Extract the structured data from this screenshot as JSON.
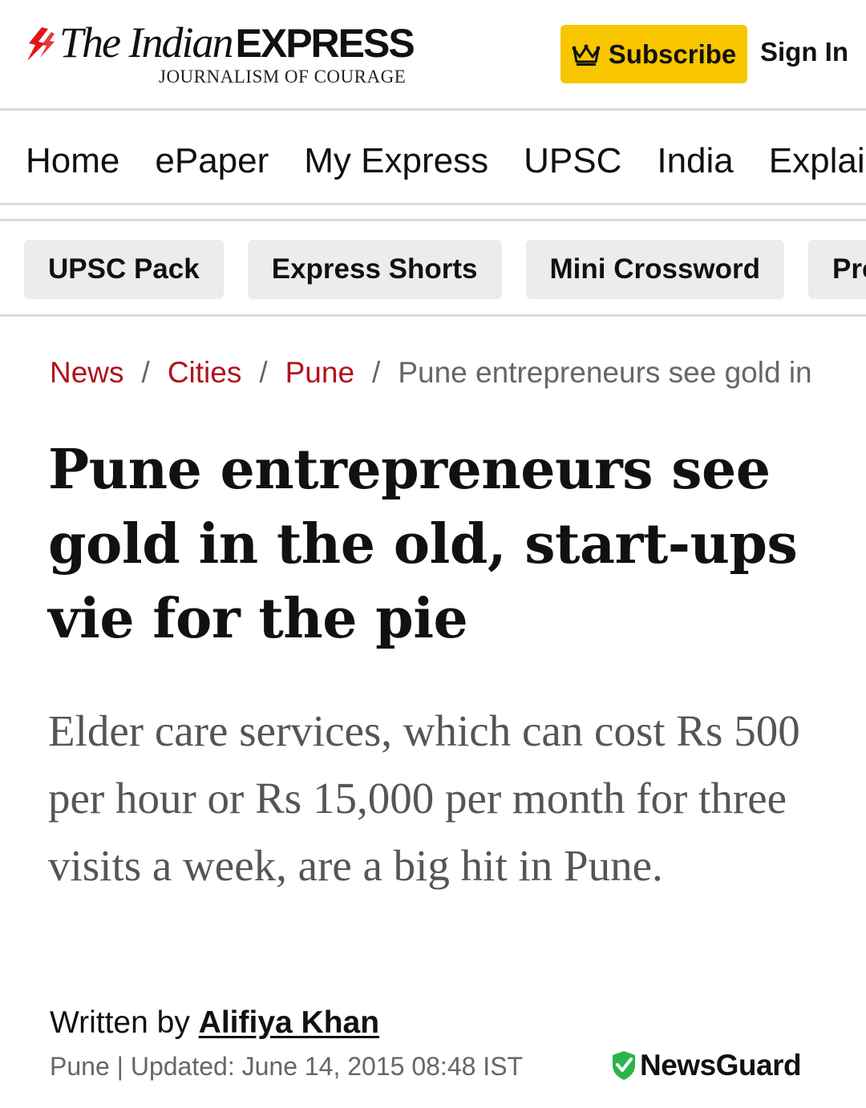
{
  "header": {
    "logo_serif": "The Indian",
    "logo_bold": "EXPRESS",
    "tagline": "JOURNALISM OF COURAGE",
    "subscribe_label": "Subscribe",
    "signin_label": "Sign In",
    "brand_color": "#e3151b",
    "subscribe_color": "#f7c600"
  },
  "nav": {
    "items": [
      "Home",
      "ePaper",
      "My Express",
      "UPSC",
      "India",
      "Explained"
    ]
  },
  "pills": {
    "items": [
      "UPSC Pack",
      "Express Shorts",
      "Mini Crossword",
      "Premium"
    ]
  },
  "breadcrumb": {
    "items": [
      "News",
      "Cities",
      "Pune"
    ],
    "current": "Pune entrepreneurs see gold in the old, start-ups vie for the pie",
    "separator": "/",
    "link_color": "#b3121b"
  },
  "article": {
    "headline": "Pune entrepreneurs see gold in the old, start-ups vie for the pie",
    "dek": "Elder care services, which can cost Rs 500 per hour or Rs 15,000 per month for three visits a week, are a big hit in Pune.",
    "byline_prefix": "Written by ",
    "author": "Alifiya Khan",
    "dateline": "Pune | Updated: June 14, 2015 08:48 IST"
  },
  "badge": {
    "label": "NewsGuard",
    "icon": "shield-check-icon",
    "color": "#2cb34a"
  }
}
